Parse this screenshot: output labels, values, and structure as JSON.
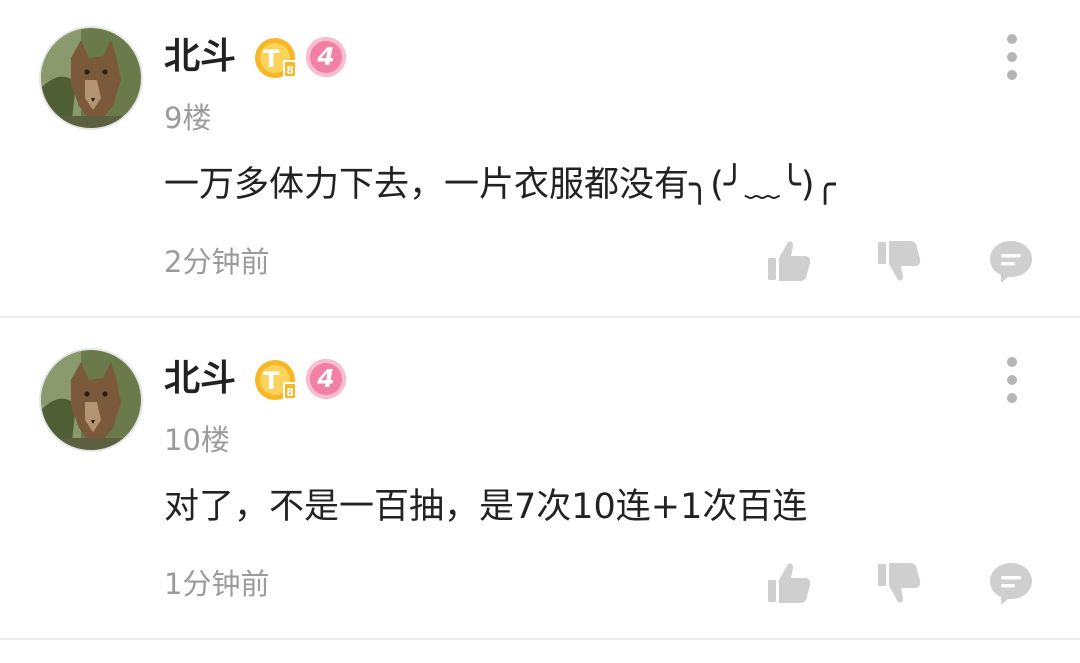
{
  "comments": [
    {
      "username": "北斗",
      "badge_letter": "T",
      "badge_sub": "8",
      "level": "4",
      "floor": "9楼",
      "content": "一万多体力下去，一片衣服都没有╮(╯﹏╰)╭",
      "time": "2分钟前"
    },
    {
      "username": "北斗",
      "badge_letter": "T",
      "badge_sub": "8",
      "level": "4",
      "floor": "10楼",
      "content": "对了，不是一百抽，是7次10连+1次百连",
      "time": "1分钟前"
    }
  ],
  "icons": {
    "avatar": "wolf-avatar",
    "badge": "gold-t-coin-badge",
    "more": "more-vertical-icon",
    "like": "thumbs-up-icon",
    "dislike": "thumbs-down-icon",
    "reply": "comment-bubble-icon"
  },
  "colors": {
    "text_primary": "#222222",
    "text_secondary": "#9b9b9b",
    "icon_gray": "#cfcfcf",
    "level_badge": "#f27fa4",
    "coin_gold": "#f6b626",
    "divider": "#ececec"
  }
}
